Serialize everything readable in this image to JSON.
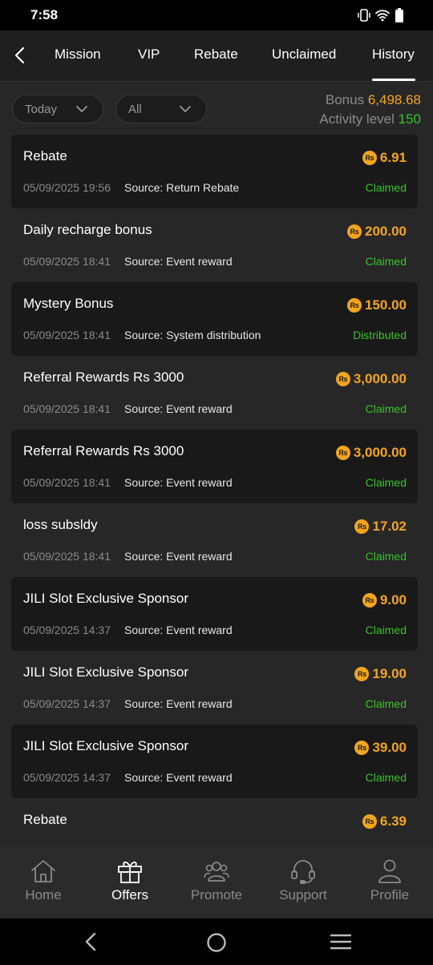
{
  "status_bar": {
    "time": "7:58",
    "icons": [
      "vibrate-icon",
      "wifi-icon",
      "battery-icon"
    ]
  },
  "tabs": [
    {
      "label": "Mission",
      "active": false
    },
    {
      "label": "VIP",
      "active": false
    },
    {
      "label": "Rebate",
      "active": false
    },
    {
      "label": "Unclaimed",
      "active": false
    },
    {
      "label": "History",
      "active": true
    }
  ],
  "filters": {
    "date": "Today",
    "type": "All"
  },
  "summary": {
    "bonus_label": "Bonus",
    "bonus_value": "6,498.68",
    "activity_label": "Activity level",
    "activity_value": "150"
  },
  "currency_symbol": "Rs",
  "records": [
    {
      "title": "Rebate",
      "date": "05/09/2025 19:56",
      "source": "Source: Return Rebate",
      "amount": "6.91",
      "status": "Claimed"
    },
    {
      "title": "Daily recharge bonus",
      "date": "05/09/2025 18:41",
      "source": "Source: Event reward",
      "amount": "200.00",
      "status": "Claimed"
    },
    {
      "title": "Mystery Bonus",
      "date": "05/09/2025 18:41",
      "source": "Source: System distribution",
      "amount": "150.00",
      "status": "Distributed"
    },
    {
      "title": "Referral Rewards Rs 3000",
      "date": "05/09/2025 18:41",
      "source": "Source: Event reward",
      "amount": "3,000.00",
      "status": "Claimed"
    },
    {
      "title": "Referral Rewards Rs 3000",
      "date": "05/09/2025 18:41",
      "source": "Source: Event reward",
      "amount": "3,000.00",
      "status": "Claimed"
    },
    {
      "title": "loss subsldy",
      "date": "05/09/2025 18:41",
      "source": "Source: Event reward",
      "amount": "17.02",
      "status": "Claimed"
    },
    {
      "title": "JILI Slot Exclusive Sponsor",
      "date": "05/09/2025 14:37",
      "source": "Source: Event reward",
      "amount": "9.00",
      "status": "Claimed"
    },
    {
      "title": "JILI Slot Exclusive Sponsor",
      "date": "05/09/2025 14:37",
      "source": "Source: Event reward",
      "amount": "19.00",
      "status": "Claimed"
    },
    {
      "title": "JILI Slot Exclusive Sponsor",
      "date": "05/09/2025 14:37",
      "source": "Source: Event reward",
      "amount": "39.00",
      "status": "Claimed"
    },
    {
      "title": "Rebate",
      "date": "",
      "source": "",
      "amount": "6.39",
      "status": ""
    }
  ],
  "bottom_nav": [
    {
      "label": "Home",
      "icon": "home-icon",
      "active": false
    },
    {
      "label": "Offers",
      "icon": "gift-icon",
      "active": true
    },
    {
      "label": "Promote",
      "icon": "users-icon",
      "active": false
    },
    {
      "label": "Support",
      "icon": "headset-icon",
      "active": false
    },
    {
      "label": "Profile",
      "icon": "profile-icon",
      "active": false
    }
  ],
  "colors": {
    "accent_gold": "#f3a51d",
    "status_green": "#39c32c",
    "background": "#272727",
    "card_dark": "#191919"
  }
}
